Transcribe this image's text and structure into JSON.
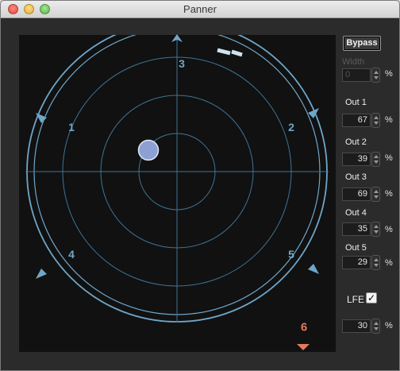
{
  "window": {
    "title": "Panner"
  },
  "panner": {
    "colors": {
      "ring": "#6fa6c9",
      "background": "#111111",
      "lfe": "#e07a5f",
      "puck": "#8da0d4"
    },
    "channels": [
      {
        "label": "1",
        "speaker_icon": "speaker-icon"
      },
      {
        "label": "2",
        "speaker_icon": "speaker-icon"
      },
      {
        "label": "3",
        "speaker_icon": "speaker-icon"
      },
      {
        "label": "4",
        "speaker_icon": "speaker-icon"
      },
      {
        "label": "5",
        "speaker_icon": "speaker-icon"
      },
      {
        "label": "6",
        "speaker_icon": "speaker-icon"
      }
    ]
  },
  "controls": {
    "bypass_label": "Bypass",
    "width": {
      "label": "Width",
      "value": "0",
      "unit": "%"
    },
    "outputs": [
      {
        "label": "Out 1",
        "value": "67",
        "unit": "%"
      },
      {
        "label": "Out 2",
        "value": "39",
        "unit": "%"
      },
      {
        "label": "Out 3",
        "value": "69",
        "unit": "%"
      },
      {
        "label": "Out 4",
        "value": "35",
        "unit": "%"
      },
      {
        "label": "Out 5",
        "value": "29",
        "unit": "%"
      }
    ],
    "lfe": {
      "label": "LFE",
      "checked": true,
      "check_mark": "✓",
      "value": "30",
      "unit": "%"
    }
  }
}
